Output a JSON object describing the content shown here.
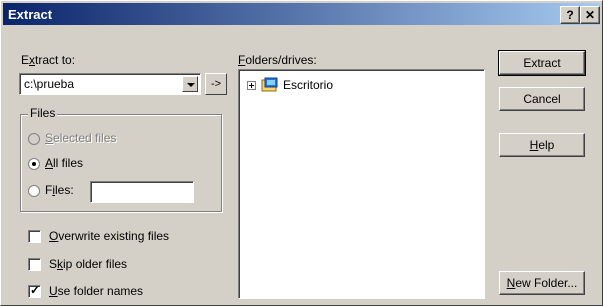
{
  "window": {
    "title": "Extract",
    "help_btn": "?",
    "close_btn": "✕"
  },
  "extract_to": {
    "label_pre": "E",
    "label_u": "x",
    "label_post": "tract to:",
    "value": "c:\\prueba",
    "go_btn": "->"
  },
  "files_group": {
    "legend": "Files",
    "selected": {
      "u": "S",
      "rest": "elected files"
    },
    "all": {
      "u": "A",
      "rest": "ll files"
    },
    "files": {
      "pre": "F",
      "u": "i",
      "rest": "les:"
    },
    "files_value": ""
  },
  "options": {
    "overwrite": {
      "u": "O",
      "rest": "verwrite existing files",
      "checked": false
    },
    "skip": {
      "pre": "S",
      "u": "k",
      "rest": "ip older files",
      "checked": false
    },
    "use_folder": {
      "u": "U",
      "rest": "se folder names",
      "checked": true
    }
  },
  "folders": {
    "label_u": "F",
    "label_rest": "olders/drives:",
    "tree": [
      {
        "name": "Escritorio",
        "icon": "desktop-folder-icon"
      }
    ]
  },
  "buttons": {
    "extract": "Extract",
    "cancel": "Cancel",
    "help_u": "H",
    "help_rest": "elp",
    "new_folder_u": "N",
    "new_folder_rest": "ew Folder..."
  }
}
